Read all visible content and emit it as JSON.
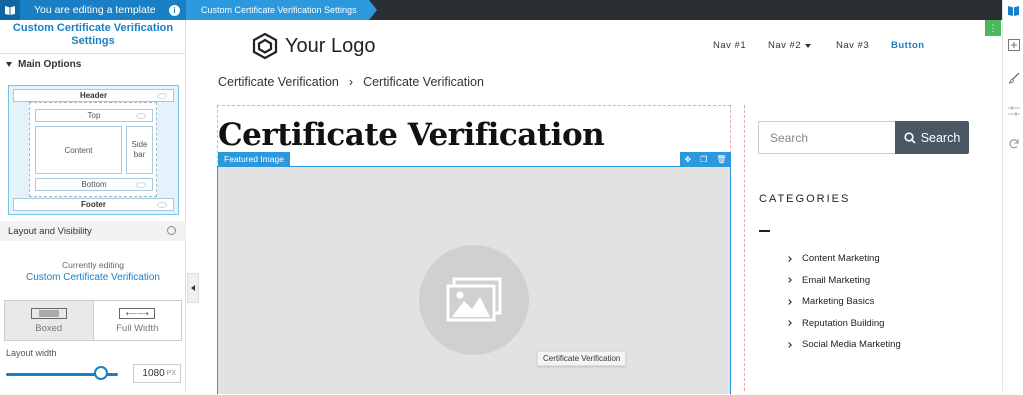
{
  "topbar": {
    "editing_label": "You are editing a template",
    "crumb": "Custom Certificate Verification Settings"
  },
  "panel": {
    "title": "Custom Certificate Verification Settings",
    "section": "Main Options",
    "layout": {
      "header": "Header",
      "top": "Top",
      "content": "Content",
      "sidebar": "Side bar",
      "bottom": "Bottom",
      "footer": "Footer"
    },
    "layout_visibility": "Layout and Visibility",
    "currently_editing_label": "Currently editing",
    "currently_editing_name": "Custom Certificate Verification",
    "width_options": [
      "Boxed",
      "Full Width"
    ],
    "selected_width": "Boxed",
    "layout_width_label": "Layout width",
    "layout_width_value": "1080",
    "layout_width_unit": "PX",
    "layout_width_fraction": 0.85
  },
  "site": {
    "logo": "Your Logo",
    "nav": [
      "Nav #1",
      "Nav #2",
      "Nav #3"
    ],
    "nav_button": "Button",
    "breadcrumb": [
      "Certificate Verification",
      "Certificate Verification"
    ],
    "page_title": "Certificate Verification",
    "featured_image_label": "Featured Image",
    "tooltip": "Certificate Verification",
    "search_placeholder": "Search",
    "search_button": "Search",
    "categories_heading": "CATEGORIES",
    "categories": [
      "Content Marketing",
      "Email Marketing",
      "Marketing Basics",
      "Reputation Building",
      "Social Media Marketing"
    ]
  },
  "colors": {
    "accent": "#1a7fc4",
    "accent_light": "#2c98de",
    "search_button": "#4a5866",
    "green": "#4cb85c"
  }
}
